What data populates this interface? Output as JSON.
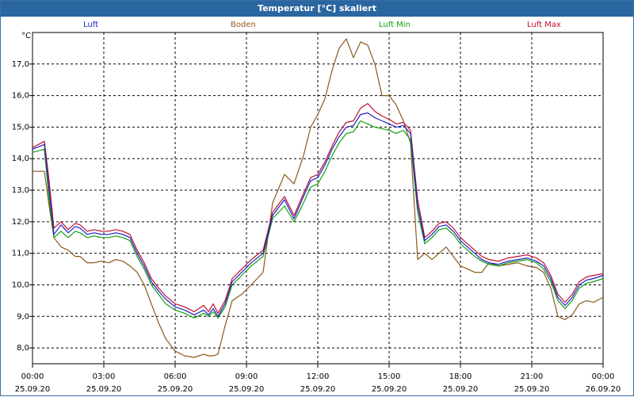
{
  "title": "Temperatur [°C] skaliert",
  "unit": "°C",
  "chart_data": {
    "type": "line",
    "title": "Temperatur [°C] skaliert",
    "ylabel": "°C",
    "xlabel": "",
    "ylim": [
      7.5,
      18.0
    ],
    "xlim_hours": [
      0,
      24
    ],
    "grid": true,
    "legend_position": "top",
    "yticks": [
      8.0,
      9.0,
      10.0,
      11.0,
      12.0,
      13.0,
      14.0,
      15.0,
      16.0,
      17.0
    ],
    "ytick_labels": [
      "8,0",
      "9,0",
      "10,0",
      "11,0",
      "12,0",
      "13,0",
      "14,0",
      "15,0",
      "16,0",
      "17,0"
    ],
    "xticks": [
      {
        "time": "00:00",
        "date": "25.09.20"
      },
      {
        "time": "03:00",
        "date": "25.09.20"
      },
      {
        "time": "06:00",
        "date": "25.09.20"
      },
      {
        "time": "09:00",
        "date": "25.09.20"
      },
      {
        "time": "12:00",
        "date": "25.09.20"
      },
      {
        "time": "15:00",
        "date": "25.09.20"
      },
      {
        "time": "18:00",
        "date": "25.09.20"
      },
      {
        "time": "21:00",
        "date": "25.09.20"
      },
      {
        "time": "00:00",
        "date": "26.09.20"
      }
    ],
    "x": [
      0,
      0.5,
      0.7,
      0.9,
      1.2,
      1.5,
      1.8,
      2.0,
      2.3,
      2.6,
      2.9,
      3.2,
      3.5,
      3.8,
      4.1,
      4.4,
      4.7,
      5.0,
      5.3,
      5.6,
      6.0,
      6.4,
      6.8,
      7.2,
      7.4,
      7.6,
      7.8,
      8.1,
      8.4,
      8.8,
      9.2,
      9.7,
      10.1,
      10.6,
      11.0,
      11.4,
      11.7,
      12.0,
      12.3,
      12.6,
      12.9,
      13.2,
      13.5,
      13.8,
      14.1,
      14.4,
      14.7,
      15.0,
      15.3,
      15.6,
      15.9,
      16.2,
      16.5,
      16.8,
      17.1,
      17.4,
      17.7,
      18.0,
      18.3,
      18.6,
      18.9,
      19.2,
      19.6,
      20.0,
      20.4,
      20.8,
      21.2,
      21.5,
      21.8,
      22.1,
      22.4,
      22.7,
      23.0,
      23.3,
      23.6,
      24.0
    ],
    "series": [
      {
        "name": "Luft",
        "color": "#2020c8",
        "values": [
          14.3,
          14.45,
          13.0,
          11.6,
          11.9,
          11.65,
          11.85,
          11.8,
          11.6,
          11.65,
          11.6,
          11.6,
          11.65,
          11.6,
          11.5,
          11.0,
          10.6,
          10.1,
          9.8,
          9.55,
          9.3,
          9.2,
          9.05,
          9.2,
          9.05,
          9.25,
          9.0,
          9.4,
          10.1,
          10.4,
          10.7,
          11.0,
          12.2,
          12.7,
          12.1,
          12.8,
          13.3,
          13.4,
          13.8,
          14.3,
          14.7,
          15.0,
          15.05,
          15.4,
          15.45,
          15.3,
          15.2,
          15.1,
          15.0,
          15.05,
          14.8,
          12.5,
          11.4,
          11.6,
          11.85,
          11.9,
          11.7,
          11.4,
          11.2,
          11.0,
          10.8,
          10.7,
          10.65,
          10.75,
          10.8,
          10.85,
          10.75,
          10.6,
          10.2,
          9.6,
          9.35,
          9.6,
          10.0,
          10.15,
          10.2,
          10.3
        ]
      },
      {
        "name": "Boden",
        "color": "#8a5a1a",
        "values": [
          13.6,
          13.6,
          12.5,
          11.5,
          11.2,
          11.1,
          10.9,
          10.9,
          10.7,
          10.7,
          10.75,
          10.7,
          10.8,
          10.75,
          10.6,
          10.4,
          10.0,
          9.4,
          8.8,
          8.3,
          7.9,
          7.75,
          7.7,
          7.8,
          7.75,
          7.75,
          7.8,
          8.7,
          9.5,
          9.7,
          10.0,
          10.4,
          12.6,
          13.5,
          13.2,
          14.1,
          15.0,
          15.4,
          15.9,
          16.8,
          17.5,
          17.8,
          17.2,
          17.7,
          17.6,
          17.0,
          16.0,
          16.0,
          15.7,
          15.2,
          14.5,
          10.8,
          11.0,
          10.8,
          11.0,
          11.2,
          10.9,
          10.6,
          10.5,
          10.4,
          10.4,
          10.7,
          10.6,
          10.65,
          10.7,
          10.6,
          10.55,
          10.4,
          9.9,
          9.0,
          8.9,
          9.05,
          9.4,
          9.5,
          9.45,
          9.6
        ]
      },
      {
        "name": "Luft Min",
        "color": "#10a010",
        "values": [
          14.2,
          14.3,
          12.7,
          11.5,
          11.7,
          11.5,
          11.7,
          11.65,
          11.5,
          11.55,
          11.5,
          11.5,
          11.55,
          11.5,
          11.4,
          10.9,
          10.5,
          10.0,
          9.7,
          9.4,
          9.2,
          9.1,
          8.95,
          9.1,
          9.0,
          9.15,
          8.95,
          9.3,
          10.0,
          10.3,
          10.6,
          10.9,
          12.1,
          12.5,
          12.0,
          12.6,
          13.1,
          13.2,
          13.6,
          14.1,
          14.5,
          14.8,
          14.85,
          15.2,
          15.1,
          15.0,
          14.95,
          14.9,
          14.8,
          14.9,
          14.6,
          12.3,
          11.3,
          11.5,
          11.75,
          11.8,
          11.6,
          11.3,
          11.1,
          10.9,
          10.75,
          10.65,
          10.6,
          10.7,
          10.75,
          10.8,
          10.7,
          10.5,
          10.1,
          9.5,
          9.25,
          9.5,
          9.9,
          10.05,
          10.1,
          10.2
        ]
      },
      {
        "name": "Luft Max",
        "color": "#c01030",
        "values": [
          14.35,
          14.55,
          13.3,
          11.8,
          12.0,
          11.75,
          11.95,
          11.9,
          11.7,
          11.75,
          11.7,
          11.7,
          11.75,
          11.7,
          11.6,
          11.1,
          10.7,
          10.2,
          9.9,
          9.65,
          9.4,
          9.3,
          9.15,
          9.35,
          9.15,
          9.4,
          9.1,
          9.5,
          10.2,
          10.5,
          10.8,
          11.1,
          12.3,
          12.8,
          12.2,
          12.9,
          13.4,
          13.5,
          13.9,
          14.4,
          14.85,
          15.15,
          15.2,
          15.6,
          15.75,
          15.5,
          15.35,
          15.25,
          15.1,
          15.15,
          14.9,
          12.7,
          11.5,
          11.7,
          11.95,
          12.0,
          11.8,
          11.5,
          11.3,
          11.1,
          10.9,
          10.8,
          10.75,
          10.85,
          10.9,
          10.95,
          10.85,
          10.7,
          10.3,
          9.7,
          9.45,
          9.7,
          10.1,
          10.25,
          10.3,
          10.35
        ]
      }
    ]
  }
}
